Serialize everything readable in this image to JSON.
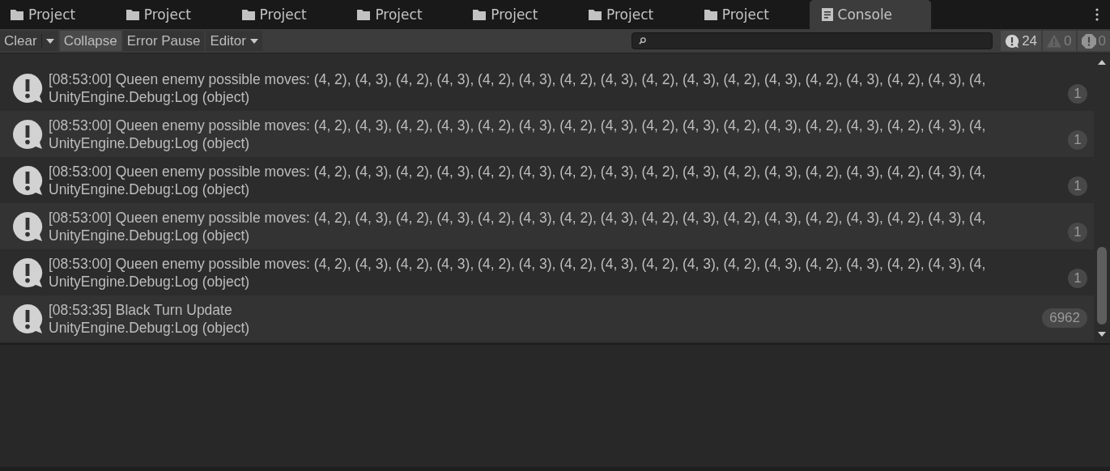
{
  "tabs": [
    {
      "label": "Project",
      "kind": "folder",
      "selected": false
    },
    {
      "label": "Project",
      "kind": "folder",
      "selected": false
    },
    {
      "label": "Project",
      "kind": "folder",
      "selected": false
    },
    {
      "label": "Project",
      "kind": "folder",
      "selected": false
    },
    {
      "label": "Project",
      "kind": "folder",
      "selected": false
    },
    {
      "label": "Project",
      "kind": "folder",
      "selected": false
    },
    {
      "label": "Project",
      "kind": "folder",
      "selected": false
    },
    {
      "label": "Console",
      "kind": "console",
      "selected": true
    }
  ],
  "toolbar": {
    "buttons": [
      {
        "label": "Clear",
        "kind": "split",
        "on": false
      },
      {
        "label": "Collapse",
        "kind": "toggle",
        "on": true
      },
      {
        "label": "Error Pause",
        "kind": "toggle",
        "on": false
      },
      {
        "label": "Editor",
        "kind": "dropdown",
        "on": false
      }
    ],
    "counters": [
      {
        "kind": "log",
        "count": "24",
        "dimmed": false
      },
      {
        "kind": "warning",
        "count": "0",
        "dimmed": true
      },
      {
        "kind": "error",
        "count": "0",
        "dimmed": true
      }
    ]
  },
  "entries": [
    {
      "message": "[08:53:00] Queen enemy possible moves: (4, 2), (4, 3), (4, 2), (4, 3), (4, 2), (4, 3), (4, 2), (4, 3), (4, 2), (4, 3), (4, 2), (4, 3), (4, 2), (4, 3), (4, 2), (4, 3), (4,",
      "source": "UnityEngine.Debug:Log (object)",
      "count": "1"
    },
    {
      "message": "[08:53:00] Queen enemy possible moves: (4, 2), (4, 3), (4, 2), (4, 3), (4, 2), (4, 3), (4, 2), (4, 3), (4, 2), (4, 3), (4, 2), (4, 3), (4, 2), (4, 3), (4, 2), (4, 3), (4,",
      "source": "UnityEngine.Debug:Log (object)",
      "count": "1"
    },
    {
      "message": "[08:53:00] Queen enemy possible moves: (4, 2), (4, 3), (4, 2), (4, 3), (4, 2), (4, 3), (4, 2), (4, 3), (4, 2), (4, 3), (4, 2), (4, 3), (4, 2), (4, 3), (4, 2), (4, 3), (4,",
      "source": "UnityEngine.Debug:Log (object)",
      "count": "1"
    },
    {
      "message": "[08:53:00] Queen enemy possible moves: (4, 2), (4, 3), (4, 2), (4, 3), (4, 2), (4, 3), (4, 2), (4, 3), (4, 2), (4, 3), (4, 2), (4, 3), (4, 2), (4, 3), (4, 2), (4, 3), (4,",
      "source": "UnityEngine.Debug:Log (object)",
      "count": "1"
    },
    {
      "message": "[08:53:00] Queen enemy possible moves: (4, 2), (4, 3), (4, 2), (4, 3), (4, 2), (4, 3), (4, 2), (4, 3), (4, 2), (4, 3), (4, 2), (4, 3), (4, 2), (4, 3), (4, 2), (4, 3), (4,",
      "source": "UnityEngine.Debug:Log (object)",
      "count": "1"
    },
    {
      "message": "[08:53:35] Black Turn Update",
      "source": "UnityEngine.Debug:Log (object)",
      "count": "6962"
    }
  ]
}
